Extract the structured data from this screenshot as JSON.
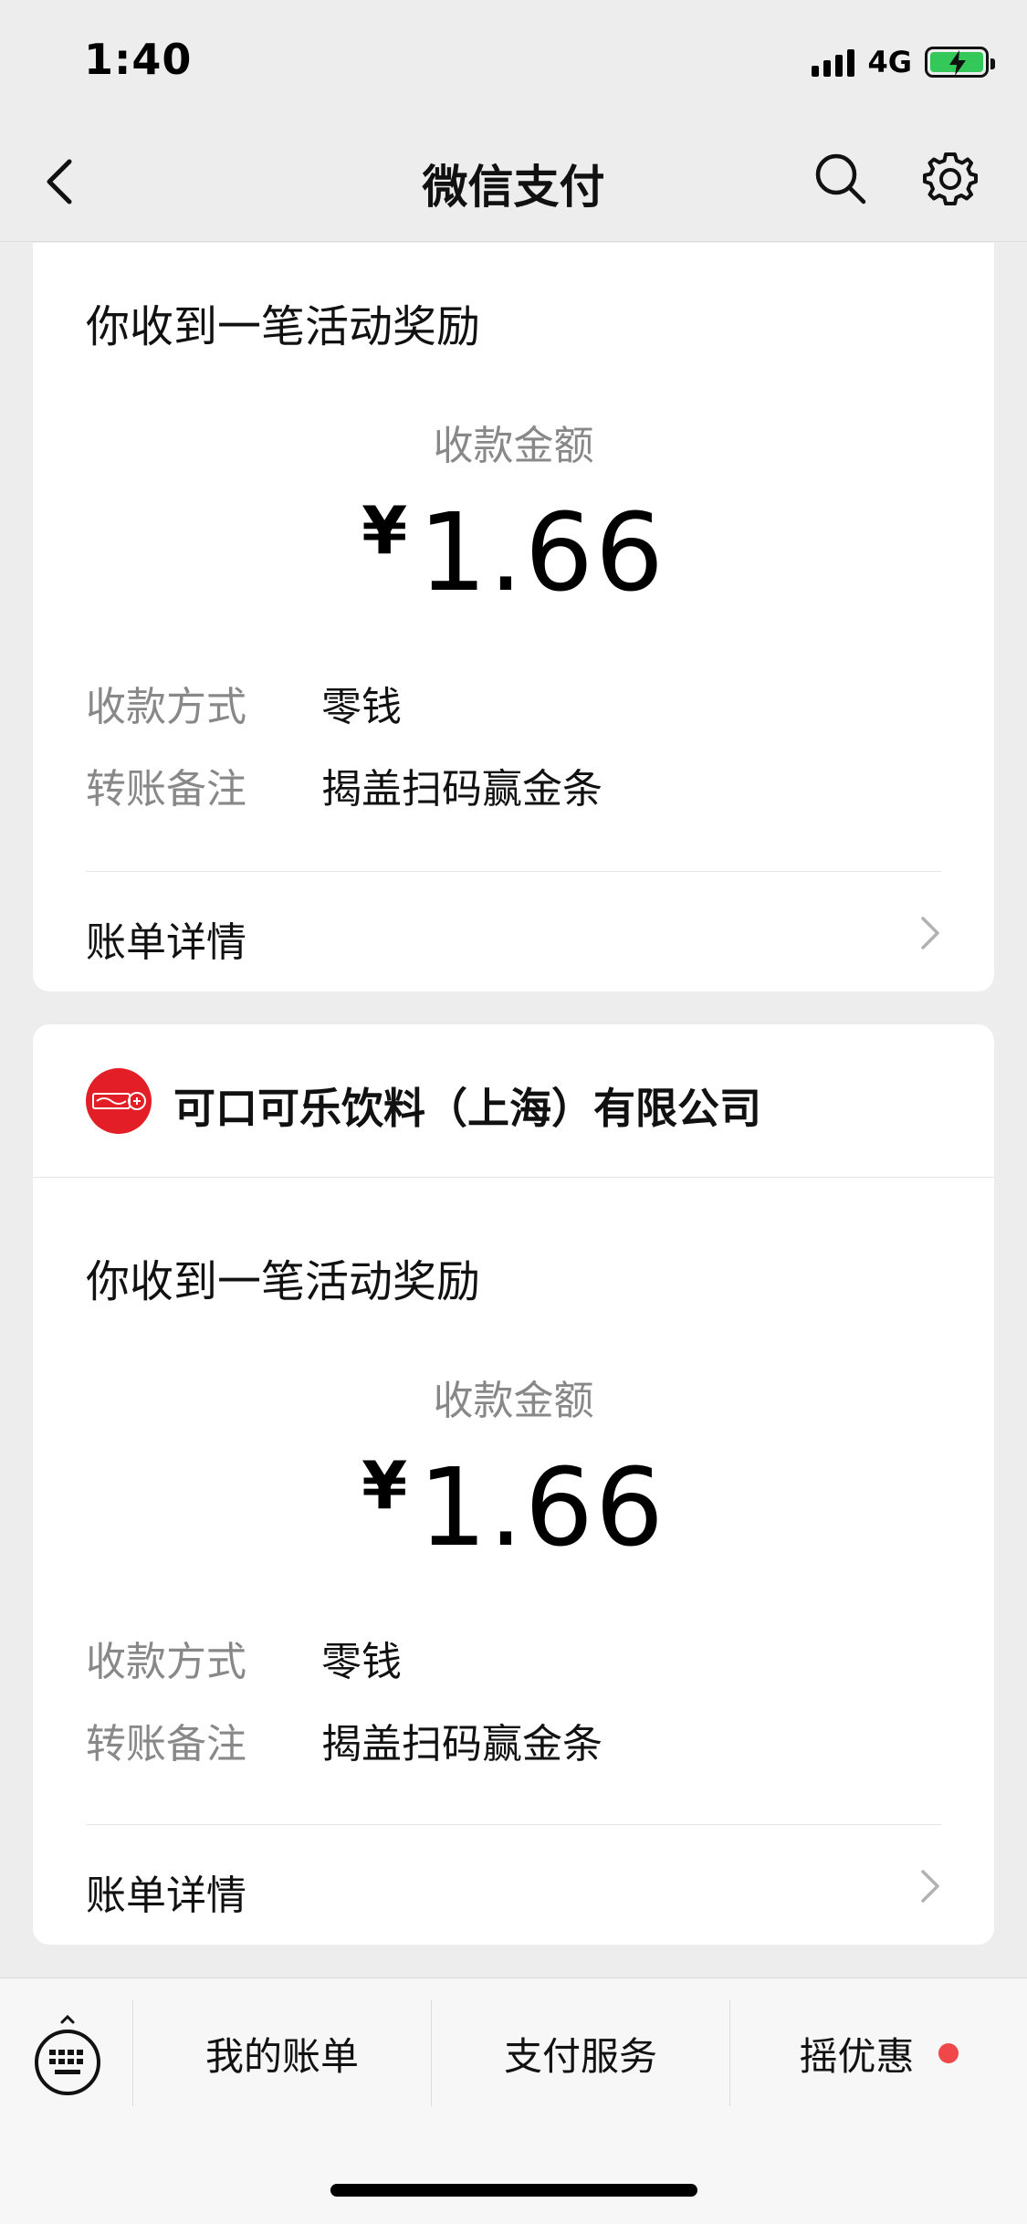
{
  "status_bar": {
    "time": "1:40",
    "network": "4G"
  },
  "nav": {
    "title": "微信支付",
    "back_icon": "chevron-left-icon",
    "search_icon": "search-icon",
    "settings_icon": "gear-icon"
  },
  "cards": [
    {
      "title": "你收到一笔活动奖励",
      "amount_label": "收款金额",
      "currency": "¥",
      "amount": "1.66",
      "method_label": "收款方式",
      "method_value": "零钱",
      "note_label": "转账备注",
      "note_value": "揭盖扫码赢金条",
      "detail_link": "账单详情"
    },
    {
      "merchant_name": "可口可乐饮料（上海）有限公司",
      "title": "你收到一笔活动奖励",
      "amount_label": "收款金额",
      "currency": "¥",
      "amount": "1.66",
      "method_label": "收款方式",
      "method_value": "零钱",
      "note_label": "转账备注",
      "note_value": "揭盖扫码赢金条",
      "detail_link": "账单详情"
    }
  ],
  "bottom_bar": {
    "keyboard_icon": "keyboard-icon",
    "tabs": [
      {
        "label": "我的账单"
      },
      {
        "label": "支付服务"
      },
      {
        "label": "摇优惠",
        "badge": "red-dot"
      }
    ]
  },
  "colors": {
    "background": "#ededed",
    "card": "#ffffff",
    "muted_text": "#888888",
    "brand_red": "#e41e26",
    "battery_green": "#34c759",
    "dot_red": "#f0484a"
  }
}
